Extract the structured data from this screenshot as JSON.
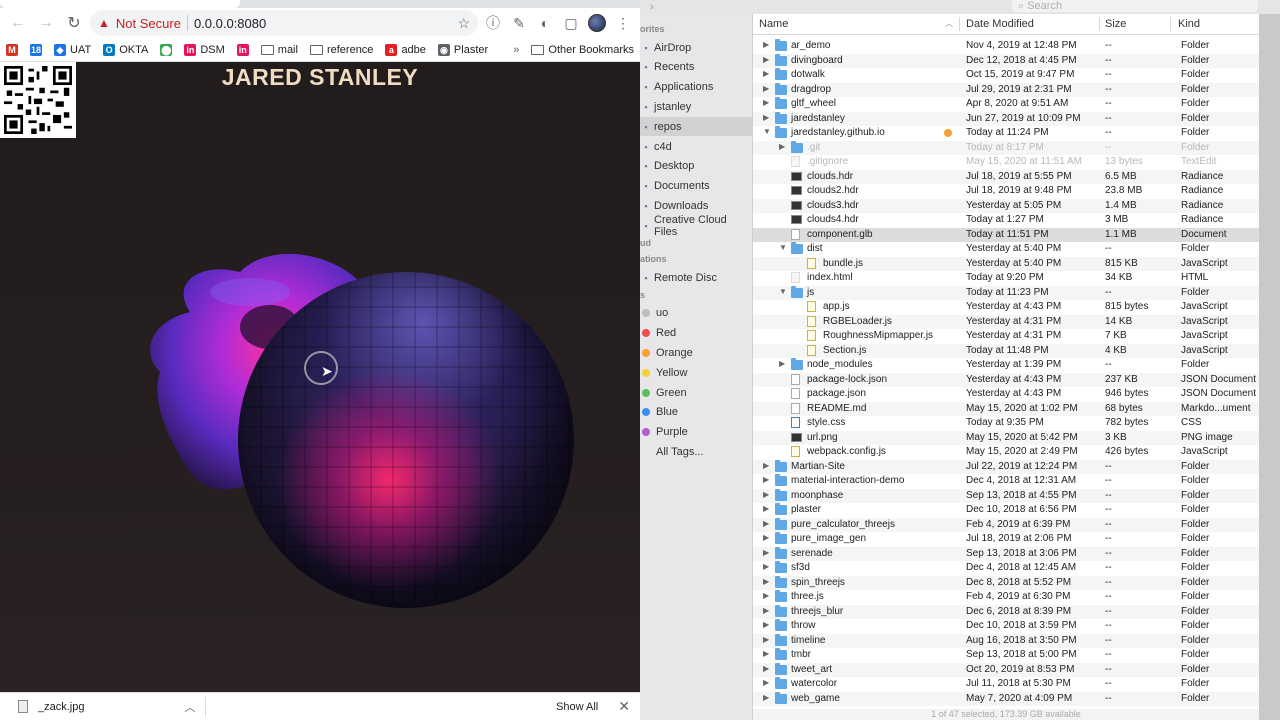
{
  "browser": {
    "url_warning": "Not Secure",
    "url": "0.0.0.0:8080",
    "bookmarks": [
      {
        "label": "",
        "icon": "gmail-icon",
        "color": "#d93025",
        "glyph": "M"
      },
      {
        "label": "",
        "icon": "calendar-icon",
        "color": "#1a73e8",
        "glyph": "18"
      },
      {
        "label": "UAT",
        "icon": "diamond-icon",
        "color": "#1a73e8",
        "glyph": "◆"
      },
      {
        "label": "OKTA",
        "icon": "okta-icon",
        "color": "#007dc1",
        "glyph": "O"
      },
      {
        "label": "",
        "icon": "maps-pin-icon",
        "color": "#34a853",
        "glyph": "⬤"
      },
      {
        "label": "DSM",
        "icon": "invision-icon",
        "color": "#e3165b",
        "glyph": "in"
      },
      {
        "label": "",
        "icon": "invision-icon",
        "color": "#e3165b",
        "glyph": "in"
      },
      {
        "label": "mail",
        "icon": "folder-icon"
      },
      {
        "label": "reference",
        "icon": "folder-icon"
      },
      {
        "label": "adbe",
        "icon": "adobe-icon",
        "color": "#e31e24",
        "glyph": "a"
      },
      {
        "label": "Plaster",
        "icon": "globe-icon",
        "color": "#5f6368",
        "glyph": "◉"
      }
    ],
    "bookmarks_more": "»",
    "other_bookmarks": "Other Bookmarks",
    "page_title": "JARED STANLEY",
    "download_file": "_zack.jpg",
    "show_all": "Show All"
  },
  "finder": {
    "search_placeholder": "Search",
    "sidebar": {
      "favorites_head": "orites",
      "favorites": [
        "AirDrop",
        "Recents",
        "Applications",
        "jstanley",
        "repos",
        "c4d",
        "Desktop",
        "Documents",
        "Downloads",
        "Creative Cloud Files"
      ],
      "icloud_head": "ud",
      "locations_head": "ations",
      "locations": [
        "Remote Disc"
      ],
      "tags_head": "s",
      "tags": [
        {
          "label": "uo",
          "color": "#bdbdbd"
        },
        {
          "label": "Red",
          "color": "#ee4d4d"
        },
        {
          "label": "Orange",
          "color": "#f5a032"
        },
        {
          "label": "Yellow",
          "color": "#f3d13a"
        },
        {
          "label": "Green",
          "color": "#5ac05a"
        },
        {
          "label": "Blue",
          "color": "#3d8ef0"
        },
        {
          "label": "Purple",
          "color": "#b05dd0"
        },
        {
          "label": "All Tags...",
          "color": ""
        }
      ]
    },
    "columns": {
      "name": "Name",
      "date": "Date Modified",
      "size": "Size",
      "kind": "Kind"
    },
    "rows": [
      {
        "depth": 0,
        "disc": "▶",
        "icon": "folder",
        "name": "ar_demo",
        "date": "Nov 4, 2019 at 12:48 PM",
        "size": "--",
        "kind": "Folder"
      },
      {
        "depth": 0,
        "disc": "▶",
        "icon": "folder",
        "name": "divingboard",
        "date": "Dec 12, 2018 at 4:45 PM",
        "size": "--",
        "kind": "Folder"
      },
      {
        "depth": 0,
        "disc": "▶",
        "icon": "folder",
        "name": "dotwalk",
        "date": "Oct 15, 2019 at 9:47 PM",
        "size": "--",
        "kind": "Folder"
      },
      {
        "depth": 0,
        "disc": "▶",
        "icon": "folder",
        "name": "dragdrop",
        "date": "Jul 29, 2019 at 2:31 PM",
        "size": "--",
        "kind": "Folder"
      },
      {
        "depth": 0,
        "disc": "▶",
        "icon": "folder",
        "name": "gltf_wheel",
        "date": "Apr 8, 2020 at 9:51 AM",
        "size": "--",
        "kind": "Folder"
      },
      {
        "depth": 0,
        "disc": "▶",
        "icon": "folder",
        "name": "jaredstanley",
        "date": "Jun 27, 2019 at 10:09 PM",
        "size": "--",
        "kind": "Folder"
      },
      {
        "depth": 0,
        "disc": "▼",
        "icon": "folder",
        "name": "jaredstanley.github.io",
        "date": "Today at 11:24 PM",
        "size": "--",
        "kind": "Folder",
        "tag": "orange"
      },
      {
        "depth": 1,
        "disc": "▶",
        "icon": "folder",
        "name": ".git",
        "date": "Today at 8:17 PM",
        "size": "--",
        "kind": "Folder",
        "dim": true
      },
      {
        "depth": 1,
        "disc": "",
        "icon": "dot",
        "name": ".gitignore",
        "date": "May 15, 2020 at 11:51 AM",
        "size": "13 bytes",
        "kind": "TextEdit",
        "dim": true
      },
      {
        "depth": 1,
        "disc": "",
        "icon": "img",
        "name": "clouds.hdr",
        "date": "Jul 18, 2019 at 5:55 PM",
        "size": "6.5 MB",
        "kind": "Radiance"
      },
      {
        "depth": 1,
        "disc": "",
        "icon": "img",
        "name": "clouds2.hdr",
        "date": "Jul 18, 2019 at 9:48 PM",
        "size": "23.8 MB",
        "kind": "Radiance"
      },
      {
        "depth": 1,
        "disc": "",
        "icon": "img",
        "name": "clouds3.hdr",
        "date": "Yesterday at 5:05 PM",
        "size": "1.4 MB",
        "kind": "Radiance"
      },
      {
        "depth": 1,
        "disc": "",
        "icon": "img",
        "name": "clouds4.hdr",
        "date": "Today at 1:27 PM",
        "size": "3 MB",
        "kind": "Radiance"
      },
      {
        "depth": 1,
        "disc": "",
        "icon": "file",
        "name": "component.glb",
        "date": "Today at 11:51 PM",
        "size": "1.1 MB",
        "kind": "Document",
        "selected": true
      },
      {
        "depth": 1,
        "disc": "▼",
        "icon": "folder",
        "name": "dist",
        "date": "Yesterday at 5:40 PM",
        "size": "--",
        "kind": "Folder"
      },
      {
        "depth": 2,
        "disc": "",
        "icon": "js",
        "name": "bundle.js",
        "date": "Yesterday at 5:40 PM",
        "size": "815 KB",
        "kind": "JavaScript"
      },
      {
        "depth": 1,
        "disc": "",
        "icon": "dot",
        "name": "index.html",
        "date": "Today at 9:20 PM",
        "size": "34 KB",
        "kind": "HTML"
      },
      {
        "depth": 1,
        "disc": "▼",
        "icon": "folder",
        "name": "js",
        "date": "Today at 11:23 PM",
        "size": "--",
        "kind": "Folder"
      },
      {
        "depth": 2,
        "disc": "",
        "icon": "js",
        "name": "app.js",
        "date": "Yesterday at 4:43 PM",
        "size": "815 bytes",
        "kind": "JavaScript"
      },
      {
        "depth": 2,
        "disc": "",
        "icon": "js",
        "name": "RGBELoader.js",
        "date": "Yesterday at 4:31 PM",
        "size": "14 KB",
        "kind": "JavaScript"
      },
      {
        "depth": 2,
        "disc": "",
        "icon": "js",
        "name": "RoughnessMipmapper.js",
        "date": "Yesterday at 4:31 PM",
        "size": "7 KB",
        "kind": "JavaScript"
      },
      {
        "depth": 2,
        "disc": "",
        "icon": "js",
        "name": "Section.js",
        "date": "Today at 11:48 PM",
        "size": "4 KB",
        "kind": "JavaScript"
      },
      {
        "depth": 1,
        "disc": "▶",
        "icon": "folder",
        "name": "node_modules",
        "date": "Yesterday at 1:39 PM",
        "size": "--",
        "kind": "Folder"
      },
      {
        "depth": 1,
        "disc": "",
        "icon": "file",
        "name": "package-lock.json",
        "date": "Yesterday at 4:43 PM",
        "size": "237 KB",
        "kind": "JSON Document"
      },
      {
        "depth": 1,
        "disc": "",
        "icon": "file",
        "name": "package.json",
        "date": "Yesterday at 4:43 PM",
        "size": "946 bytes",
        "kind": "JSON Document"
      },
      {
        "depth": 1,
        "disc": "",
        "icon": "file",
        "name": "README.md",
        "date": "May 15, 2020 at 1:02 PM",
        "size": "68 bytes",
        "kind": "Markdo...ument"
      },
      {
        "depth": 1,
        "disc": "",
        "icon": "css",
        "name": "style.css",
        "date": "Today at 9:35 PM",
        "size": "782 bytes",
        "kind": "CSS"
      },
      {
        "depth": 1,
        "disc": "",
        "icon": "img",
        "name": "url.png",
        "date": "May 15, 2020 at 5:42 PM",
        "size": "3 KB",
        "kind": "PNG image"
      },
      {
        "depth": 1,
        "disc": "",
        "icon": "js",
        "name": "webpack.config.js",
        "date": "May 15, 2020 at 2:49 PM",
        "size": "426 bytes",
        "kind": "JavaScript"
      },
      {
        "depth": 0,
        "disc": "▶",
        "icon": "folder",
        "name": "Martian-Site",
        "date": "Jul 22, 2019 at 12:24 PM",
        "size": "--",
        "kind": "Folder"
      },
      {
        "depth": 0,
        "disc": "▶",
        "icon": "folder",
        "name": "material-interaction-demo",
        "date": "Dec 4, 2018 at 12:31 AM",
        "size": "--",
        "kind": "Folder"
      },
      {
        "depth": 0,
        "disc": "▶",
        "icon": "folder",
        "name": "moonphase",
        "date": "Sep 13, 2018 at 4:55 PM",
        "size": "--",
        "kind": "Folder"
      },
      {
        "depth": 0,
        "disc": "▶",
        "icon": "folder",
        "name": "plaster",
        "date": "Dec 10, 2018 at 6:56 PM",
        "size": "--",
        "kind": "Folder"
      },
      {
        "depth": 0,
        "disc": "▶",
        "icon": "folder",
        "name": "pure_calculator_threejs",
        "date": "Feb 4, 2019 at 6:39 PM",
        "size": "--",
        "kind": "Folder"
      },
      {
        "depth": 0,
        "disc": "▶",
        "icon": "folder",
        "name": "pure_image_gen",
        "date": "Jul 18, 2019 at 2:06 PM",
        "size": "--",
        "kind": "Folder"
      },
      {
        "depth": 0,
        "disc": "▶",
        "icon": "folder",
        "name": "serenade",
        "date": "Sep 13, 2018 at 3:06 PM",
        "size": "--",
        "kind": "Folder"
      },
      {
        "depth": 0,
        "disc": "▶",
        "icon": "folder",
        "name": "sf3d",
        "date": "Dec 4, 2018 at 12:45 AM",
        "size": "--",
        "kind": "Folder"
      },
      {
        "depth": 0,
        "disc": "▶",
        "icon": "folder",
        "name": "spin_threejs",
        "date": "Dec 8, 2018 at 5:52 PM",
        "size": "--",
        "kind": "Folder"
      },
      {
        "depth": 0,
        "disc": "▶",
        "icon": "folder",
        "name": "three.js",
        "date": "Feb 4, 2019 at 6:30 PM",
        "size": "--",
        "kind": "Folder"
      },
      {
        "depth": 0,
        "disc": "▶",
        "icon": "folder",
        "name": "threejs_blur",
        "date": "Dec 6, 2018 at 8:39 PM",
        "size": "--",
        "kind": "Folder"
      },
      {
        "depth": 0,
        "disc": "▶",
        "icon": "folder",
        "name": "throw",
        "date": "Dec 10, 2018 at 3:59 PM",
        "size": "--",
        "kind": "Folder"
      },
      {
        "depth": 0,
        "disc": "▶",
        "icon": "folder",
        "name": "timeline",
        "date": "Aug 16, 2018 at 3:50 PM",
        "size": "--",
        "kind": "Folder"
      },
      {
        "depth": 0,
        "disc": "▶",
        "icon": "folder",
        "name": "tmbr",
        "date": "Sep 13, 2018 at 5:00 PM",
        "size": "--",
        "kind": "Folder"
      },
      {
        "depth": 0,
        "disc": "▶",
        "icon": "folder",
        "name": "tweet_art",
        "date": "Oct 20, 2019 at 8:53 PM",
        "size": "--",
        "kind": "Folder"
      },
      {
        "depth": 0,
        "disc": "▶",
        "icon": "folder",
        "name": "watercolor",
        "date": "Jul 11, 2018 at 5:30 PM",
        "size": "--",
        "kind": "Folder"
      },
      {
        "depth": 0,
        "disc": "▶",
        "icon": "folder",
        "name": "web_game",
        "date": "May 7, 2020 at 4:09 PM",
        "size": "--",
        "kind": "Folder"
      }
    ],
    "status_text": "1 of 47 selected, 173.39 GB available"
  }
}
